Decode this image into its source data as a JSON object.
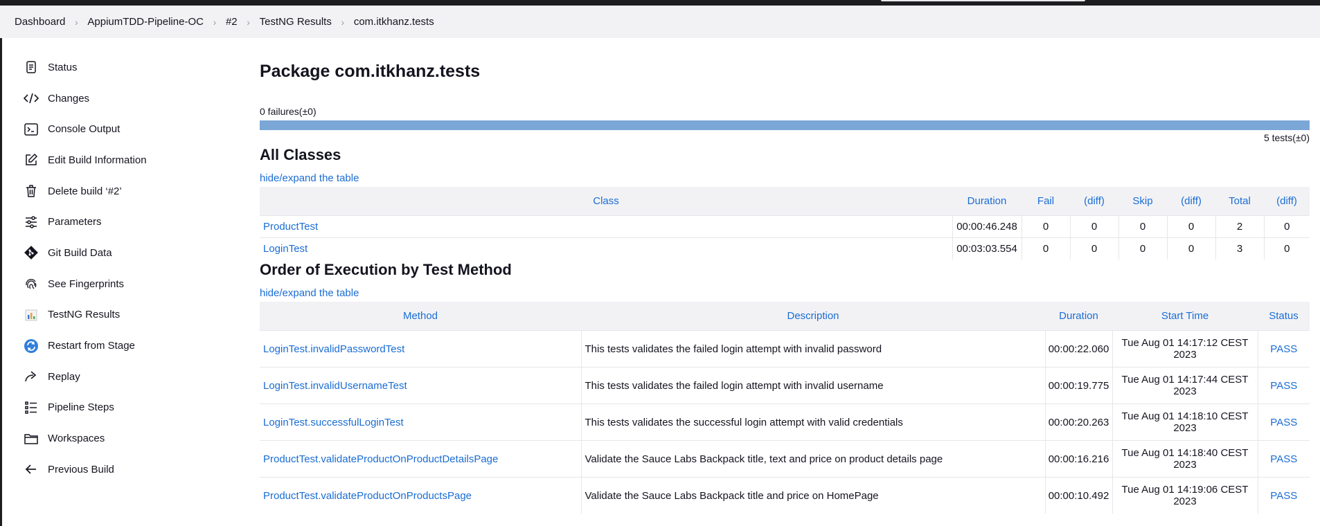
{
  "breadcrumb": [
    "Dashboard",
    "AppiumTDD-Pipeline-OC",
    "#2",
    "TestNG Results",
    "com.itkhanz.tests"
  ],
  "sidebar": {
    "items": [
      {
        "label": "Status",
        "icon": "status-icon"
      },
      {
        "label": "Changes",
        "icon": "code-icon"
      },
      {
        "label": "Console Output",
        "icon": "terminal-icon"
      },
      {
        "label": "Edit Build Information",
        "icon": "edit-icon"
      },
      {
        "label": "Delete build ‘#2’",
        "icon": "trash-icon"
      },
      {
        "label": "Parameters",
        "icon": "sliders-icon"
      },
      {
        "label": "Git Build Data",
        "icon": "git-icon"
      },
      {
        "label": "See Fingerprints",
        "icon": "fingerprint-icon"
      },
      {
        "label": "TestNG Results",
        "icon": "testng-icon"
      },
      {
        "label": "Restart from Stage",
        "icon": "restart-icon"
      },
      {
        "label": "Replay",
        "icon": "replay-icon"
      },
      {
        "label": "Pipeline Steps",
        "icon": "steps-icon"
      },
      {
        "label": "Workspaces",
        "icon": "folder-icon"
      },
      {
        "label": "Previous Build",
        "icon": "arrow-left-icon"
      }
    ]
  },
  "main": {
    "title": "Package com.itkhanz.tests",
    "failures": "0 failures(±0)",
    "failure_fraction": 0,
    "tests": "5 tests(±0)",
    "classes_heading": "All Classes",
    "toggle_label": "hide/expand the table",
    "classes_headers": [
      "Class",
      "Duration",
      "Fail",
      "(diff)",
      "Skip",
      "(diff)",
      "Total",
      "(diff)"
    ],
    "classes_rows": [
      [
        "ProductTest",
        "00:00:46.248",
        "0",
        "0",
        "0",
        "0",
        "2",
        "0"
      ],
      [
        "LoginTest",
        "00:03:03.554",
        "0",
        "0",
        "0",
        "0",
        "3",
        "0"
      ]
    ],
    "methods_heading": "Order of Execution by Test Method",
    "methods_headers": [
      "Method",
      "Description",
      "Duration",
      "Start Time",
      "Status"
    ],
    "methods_rows": [
      [
        "LoginTest.invalidPasswordTest",
        "This tests validates the failed login attempt with invalid password",
        "00:00:22.060",
        "Tue Aug 01 14:17:12 CEST 2023",
        "PASS"
      ],
      [
        "LoginTest.invalidUsernameTest",
        "This tests validates the failed login attempt with invalid username",
        "00:00:19.775",
        "Tue Aug 01 14:17:44 CEST 2023",
        "PASS"
      ],
      [
        "LoginTest.successfulLoginTest",
        "This tests validates the successful login attempt with valid credentials",
        "00:00:20.263",
        "Tue Aug 01 14:18:10 CEST 2023",
        "PASS"
      ],
      [
        "ProductTest.validateProductOnProductDetailsPage",
        "Validate the Sauce Labs Backpack title, text and price on product details page",
        "00:00:16.216",
        "Tue Aug 01 14:18:40 CEST 2023",
        "PASS"
      ],
      [
        "ProductTest.validateProductOnProductsPage",
        "Validate the Sauce Labs Backpack title and price on HomePage",
        "00:00:10.492",
        "Tue Aug 01 14:19:06 CEST 2023",
        "PASS"
      ]
    ]
  }
}
